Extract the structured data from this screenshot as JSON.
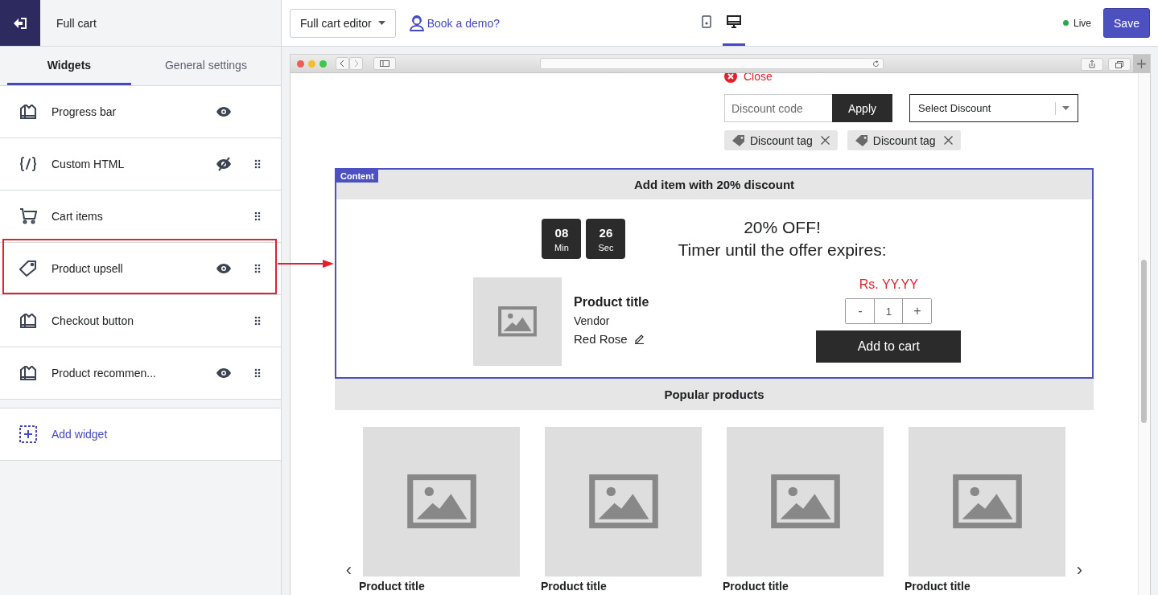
{
  "sidebar": {
    "title": "Full cart",
    "tabs": [
      {
        "label": "Widgets",
        "selected": true
      },
      {
        "label": "General settings",
        "selected": false
      }
    ],
    "widgets": [
      {
        "label": "Progress bar",
        "kind": "storefront",
        "visible": true,
        "draggable": false,
        "highlighted": false
      },
      {
        "label": "Custom HTML",
        "kind": "code",
        "visible": false,
        "draggable": true,
        "highlighted": false
      },
      {
        "label": "Cart items",
        "kind": "cart",
        "draggable": true,
        "highlighted": false
      },
      {
        "label": "Product upsell",
        "kind": "tag",
        "visible": true,
        "draggable": true,
        "highlighted": true
      },
      {
        "label": "Checkout button",
        "kind": "storefront",
        "draggable": true,
        "highlighted": false
      },
      {
        "label": "Product recommen...",
        "kind": "storefront",
        "visible": true,
        "draggable": true,
        "highlighted": false
      }
    ],
    "add_widget": "Add widget"
  },
  "toolbar": {
    "editor_select": "Full cart editor",
    "demo_link": "Book a demo?",
    "devices": [
      {
        "kind": "mobile",
        "selected": false
      },
      {
        "kind": "desktop",
        "selected": true
      }
    ],
    "status": "Live",
    "save": "Save"
  },
  "preview": {
    "close": "Close",
    "discount": {
      "placeholder": "Discount code",
      "apply": "Apply",
      "select": "Select Discount",
      "tags": [
        "Discount tag",
        "Discount tag"
      ]
    },
    "upsell": {
      "badge": "Content",
      "heading": "Add item with 20% discount",
      "timer": [
        {
          "value": "08",
          "unit": "Min"
        },
        {
          "value": "26",
          "unit": "Sec"
        }
      ],
      "offer": "20% OFF!",
      "offer_sub": "Timer until the offer expires:",
      "product": {
        "title": "Product title",
        "vendor": "Vendor",
        "variant": "Red Rose",
        "price": "Rs. YY.YY",
        "decrease": "-",
        "quantity": "1",
        "increase": "+",
        "add": "Add to cart"
      }
    },
    "popular": {
      "heading": "Popular products",
      "prev": "‹",
      "next": "›",
      "products": [
        {
          "title": "Product title"
        },
        {
          "title": "Product title"
        },
        {
          "title": "Product title"
        },
        {
          "title": "Product title"
        }
      ]
    }
  }
}
